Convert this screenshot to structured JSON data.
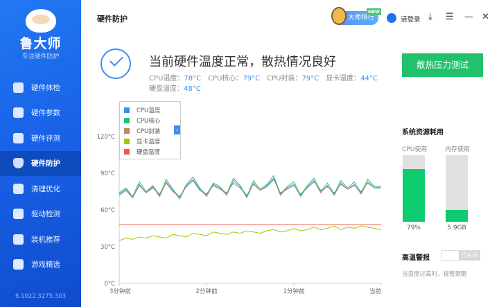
{
  "app": {
    "name": "鲁大师",
    "slogan": "专注硬件防护",
    "version": "6.1022.3275.303"
  },
  "sidebar": {
    "items": [
      {
        "label": "硬件体检",
        "icon": "monitor-icon"
      },
      {
        "label": "硬件参数",
        "icon": "sliders-icon"
      },
      {
        "label": "硬件评测",
        "icon": "gauge-icon"
      },
      {
        "label": "硬件防护",
        "icon": "shield-icon",
        "active": true
      },
      {
        "label": "清理优化",
        "icon": "broom-icon"
      },
      {
        "label": "驱动检测",
        "icon": "gear-icon"
      },
      {
        "label": "装机推荐",
        "icon": "grid-icon"
      },
      {
        "label": "游戏精选",
        "icon": "gamepad-icon"
      }
    ]
  },
  "header": {
    "title": "硬件防护",
    "rank_label": "大师排行",
    "new_badge": "NEW",
    "login_label": "请登录"
  },
  "status": {
    "message": "当前硬件温度正常，散热情况良好",
    "items": [
      {
        "label": "CPU温度：",
        "value": "78°C"
      },
      {
        "label": "CPU核心：",
        "value": "79°C"
      },
      {
        "label": "CPU封装：",
        "value": "79°C"
      },
      {
        "label": "显卡温度：",
        "value": "44°C"
      },
      {
        "label": "硬盘温度：",
        "value": "48°C"
      }
    ]
  },
  "stress_button": "散热压力测试",
  "resources": {
    "title": "系统资源耗用",
    "cpu_label": "CPU使用",
    "cpu_value": "79%",
    "cpu_percent": 79,
    "mem_label": "内存使用",
    "mem_value": "5.9GB",
    "mem_percent": 18
  },
  "alarm": {
    "title": "高温警报",
    "toggle_state": "已关闭",
    "note": "当温度过高时，报警提醒"
  },
  "colors": {
    "accent": "#3a8ef0",
    "green": "#21c26b",
    "sidebar": "#1860e6"
  },
  "chart_data": {
    "type": "line",
    "ylim": [
      0,
      120
    ],
    "yticks": [
      "0°C",
      "30°C",
      "60°C",
      "90°C",
      "120°C"
    ],
    "yvalues": [
      0,
      30,
      60,
      90,
      120
    ],
    "xticks": [
      "3分钟前",
      "2分钟前",
      "1分钟前",
      "当前"
    ],
    "series": [
      {
        "name": "CPU温度",
        "color": "#3a8ef0",
        "values": [
          72,
          76,
          70,
          80,
          74,
          78,
          73,
          82,
          75,
          71,
          79,
          84,
          76,
          73,
          80,
          77,
          74,
          82,
          78,
          72,
          81,
          76,
          79,
          85,
          74,
          77,
          80,
          73,
          78,
          83,
          76,
          79,
          74,
          81,
          77,
          80,
          75,
          82,
          78,
          78
        ]
      },
      {
        "name": "CPU核心",
        "color": "#1fc27a",
        "values": [
          74,
          78,
          71,
          83,
          75,
          80,
          72,
          85,
          77,
          70,
          81,
          87,
          78,
          72,
          82,
          79,
          73,
          86,
          80,
          71,
          84,
          77,
          81,
          88,
          73,
          79,
          83,
          72,
          80,
          86,
          75,
          82,
          73,
          84,
          78,
          83,
          74,
          85,
          79,
          79
        ]
      },
      {
        "name": "CPU封装",
        "color": "#b8866a",
        "values": [
          73,
          77,
          70,
          81,
          74,
          79,
          71,
          83,
          76,
          69,
          80,
          85,
          77,
          71,
          81,
          78,
          72,
          84,
          79,
          70,
          82,
          76,
          80,
          86,
          72,
          78,
          81,
          71,
          79,
          84,
          74,
          80,
          72,
          82,
          77,
          81,
          73,
          83,
          78,
          79
        ]
      },
      {
        "name": "显卡温度",
        "color": "#a8c400",
        "values": [
          35,
          37,
          36,
          38,
          37,
          39,
          38,
          37,
          40,
          39,
          38,
          41,
          40,
          39,
          42,
          41,
          40,
          42,
          41,
          43,
          42,
          41,
          43,
          44,
          42,
          43,
          45,
          43,
          44,
          46,
          44,
          45,
          47,
          44,
          46,
          45,
          47,
          46,
          45,
          44
        ]
      },
      {
        "name": "硬盘温度",
        "color": "#f25a4a",
        "values": [
          48,
          48,
          48,
          48,
          48,
          48,
          48,
          48,
          48,
          48,
          48,
          48,
          48,
          48,
          48,
          48,
          48,
          48,
          48,
          48,
          48,
          48,
          48,
          48,
          48,
          48,
          48,
          48,
          48,
          48,
          48,
          48,
          48,
          48,
          48,
          48,
          48,
          48,
          48,
          48
        ]
      }
    ]
  }
}
